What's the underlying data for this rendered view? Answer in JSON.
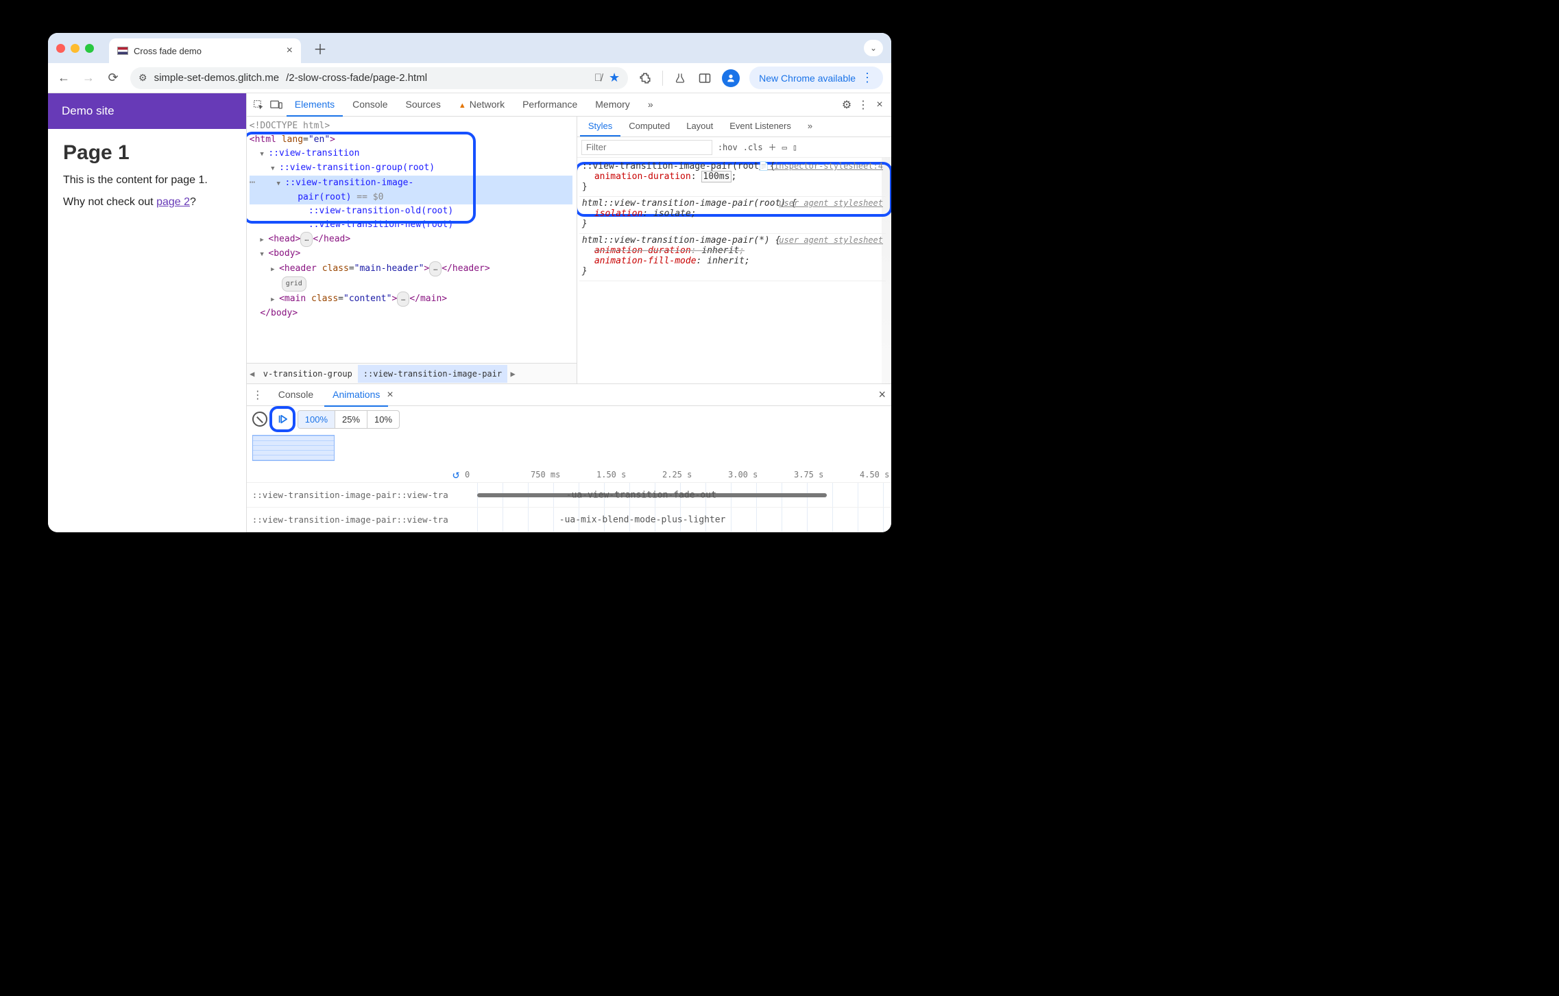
{
  "browser": {
    "tab_title": "Cross fade demo",
    "url_host": "simple-set-demos.glitch.me",
    "url_path": "/2-slow-cross-fade/page-2.html",
    "update_label": "New Chrome available"
  },
  "page": {
    "site_title": "Demo site",
    "h1": "Page 1",
    "p1": "This is the content for page 1.",
    "p2_pre": "Why not check out ",
    "p2_link": "page 2",
    "p2_post": "?"
  },
  "devtools": {
    "tabs": [
      "Elements",
      "Console",
      "Sources",
      "Network",
      "Performance",
      "Memory"
    ],
    "more": "»",
    "dom": {
      "doctype": "<!DOCTYPE html>",
      "html_open": "<html lang=\"en\">",
      "pe_view_transition": "::view-transition",
      "pe_group": "::view-transition-group(root)",
      "pe_pair_a": "::view-transition-image-",
      "pe_pair_b": "pair(root)",
      "eq0": " == $0",
      "pe_old": "::view-transition-old(root)",
      "pe_new": "::view-transition-new(root)",
      "head": "<head>",
      "head_end": "</head>",
      "body": "<body>",
      "header_open": "<header class=\"main-header\">",
      "header_end": "</header>",
      "grid_badge": "grid",
      "main_open": "<main class=\"content\">",
      "main_end": "</main>",
      "body_end": "</body>",
      "ellipsis": "…"
    },
    "breadcrumb": {
      "prev": "v-transition-group",
      "sel": "::view-transition-image-pair"
    },
    "styles": {
      "tabs": [
        "Styles",
        "Computed",
        "Layout",
        "Event Listeners"
      ],
      "more": "»",
      "filter_placeholder": "Filter",
      "hov": ":hov",
      "cls": ".cls",
      "rules": [
        {
          "source_label": "inspector-stylesheet:4",
          "selector": "::view-transition-image-pair(root) {",
          "decls": [
            {
              "prop": "animation-duration",
              "val": "100ms",
              "boxed": true
            }
          ],
          "close": "}"
        },
        {
          "source_label": "user agent stylesheet",
          "selector": "html::view-transition-image-pair(root) {",
          "italic": true,
          "decls": [
            {
              "prop": "isolation",
              "val": "isolate"
            }
          ],
          "close": "}"
        },
        {
          "source_label": "user agent stylesheet",
          "selector": "html::view-transition-image-pair(*) {",
          "italic": true,
          "decls": [
            {
              "prop": "animation-duration",
              "val": "inherit",
              "strike": true
            },
            {
              "prop": "animation-fill-mode",
              "val": "inherit"
            }
          ],
          "close": "}"
        }
      ]
    },
    "drawer": {
      "tabs": [
        "Console",
        "Animations"
      ],
      "speeds": [
        "100%",
        "25%",
        "10%"
      ],
      "ticks": [
        "0",
        "750 ms",
        "1.50 s",
        "2.25 s",
        "3.00 s",
        "3.75 s",
        "4.50 s"
      ],
      "rows": [
        {
          "el": "::view-transition-image-pair::view-tra",
          "anim": "-ua-view-transition-fade-out"
        },
        {
          "el": "::view-transition-image-pair::view-tra",
          "anim": "-ua-mix-blend-mode-plus-lighter"
        }
      ]
    }
  }
}
